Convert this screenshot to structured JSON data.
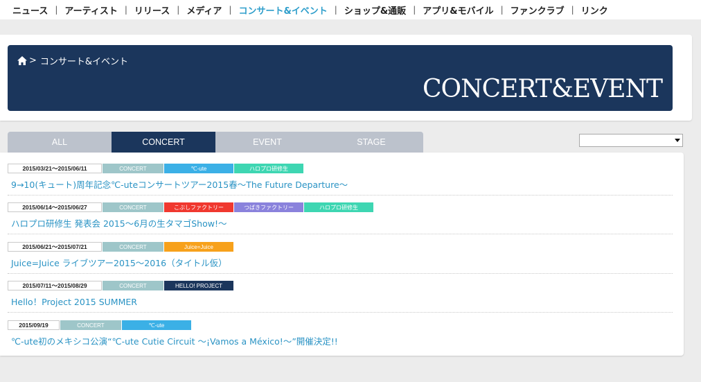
{
  "nav": [
    {
      "label": "ニュース",
      "active": false
    },
    {
      "label": "アーティスト",
      "active": false
    },
    {
      "label": "リリース",
      "active": false
    },
    {
      "label": "メディア",
      "active": false
    },
    {
      "label": "コンサート&イベント",
      "active": true
    },
    {
      "label": "ショップ&通販",
      "active": false
    },
    {
      "label": "アプリ&モバイル",
      "active": false
    },
    {
      "label": "ファンクラブ",
      "active": false
    },
    {
      "label": "リンク",
      "active": false
    }
  ],
  "nav_separator": "|",
  "breadcrumb": {
    "arrow": ">",
    "current": "コンサート&イベント"
  },
  "banner_title": "CONCERT&EVENT",
  "tabs": [
    "ALL",
    "CONCERT",
    "EVENT",
    "STAGE"
  ],
  "active_tab": "CONCERT",
  "filter_select": {
    "value": ""
  },
  "colors": {
    "navy": "#1b365c",
    "link": "#2a93c4",
    "nav_active": "#2e9ecb",
    "genre": "#9ec6c9",
    "cute": "#3bb0e6",
    "hello_pro_kenshusei": "#3ed6b2",
    "kobushi": "#f0382f",
    "tsubaki": "#8a82dc",
    "juice": "#f7a11b",
    "hello_project": "#1b365c"
  },
  "events": [
    {
      "date": "2015/03/21～2015/06/11",
      "genre": "CONCERT",
      "tags": [
        {
          "label": "℃-ute",
          "color": "#3bb0e6"
        },
        {
          "label": "ハロプロ研修生",
          "color": "#3ed6b2"
        }
      ],
      "title": "9→10(キュート)周年記念℃-uteコンサートツアー2015春～The Future Departure～"
    },
    {
      "date": "2015/06/14～2015/06/27",
      "genre": "CONCERT",
      "tags": [
        {
          "label": "こぶしファクトリー",
          "color": "#f0382f"
        },
        {
          "label": "つばきファクトリー",
          "color": "#8a82dc"
        },
        {
          "label": "ハロプロ研修生",
          "color": "#3ed6b2"
        }
      ],
      "title": "ハロプロ研修生 発表会 2015～6月の生タマゴShow!～"
    },
    {
      "date": "2015/06/21～2015/07/21",
      "genre": "CONCERT",
      "tags": [
        {
          "label": "Juice=Juice",
          "color": "#f7a11b"
        }
      ],
      "title": "Juice=Juice ライブツアー2015～2016（タイトル仮）"
    },
    {
      "date": "2015/07/11～2015/08/29",
      "genre": "CONCERT",
      "tags": [
        {
          "label": "HELLO! PROJECT",
          "color": "#1b365c"
        }
      ],
      "title": "Hello！Project 2015 SUMMER"
    },
    {
      "date": "2015/09/19",
      "genre": "CONCERT",
      "tags": [
        {
          "label": "℃-ute",
          "color": "#3bb0e6"
        }
      ],
      "title": "℃-ute初のメキシコ公演“℃-ute Cutie Circuit ～¡Vamos a México!～”開催決定!!"
    }
  ]
}
